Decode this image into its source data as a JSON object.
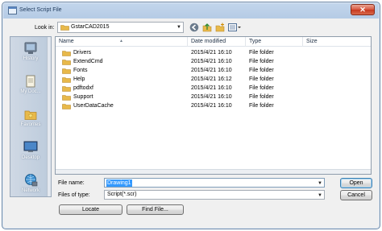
{
  "window": {
    "title": "Select Script File",
    "close_glyph": "✕"
  },
  "lookin": {
    "label": "Look in:",
    "value": "GstarCAD2015"
  },
  "places": [
    {
      "label": "History",
      "icon": "history-icon"
    },
    {
      "label": "My Doc...",
      "icon": "my-documents-icon"
    },
    {
      "label": "Favorites",
      "icon": "favorites-icon"
    },
    {
      "label": "Desktop",
      "icon": "desktop-icon"
    },
    {
      "label": "Network",
      "icon": "network-icon"
    }
  ],
  "filelist": {
    "columns": [
      "Name",
      "Date modified",
      "Type",
      "Size"
    ],
    "rows": [
      {
        "name": "Drivers",
        "date": "2015/4/21 16:10",
        "type": "File folder",
        "size": ""
      },
      {
        "name": "ExtendCmd",
        "date": "2015/4/21 16:10",
        "type": "File folder",
        "size": ""
      },
      {
        "name": "Fonts",
        "date": "2015/4/21 16:10",
        "type": "File folder",
        "size": ""
      },
      {
        "name": "Help",
        "date": "2015/4/21 16:12",
        "type": "File folder",
        "size": ""
      },
      {
        "name": "pdftodxf",
        "date": "2015/4/21 16:10",
        "type": "File folder",
        "size": ""
      },
      {
        "name": "Support",
        "date": "2015/4/21 16:10",
        "type": "File folder",
        "size": ""
      },
      {
        "name": "UserDataCache",
        "date": "2015/4/21 16:10",
        "type": "File folder",
        "size": ""
      }
    ]
  },
  "filename": {
    "label": "File name:",
    "value": "Drawing1"
  },
  "filetype": {
    "label": "Files of type:",
    "value": "Script(*.scr)"
  },
  "buttons": {
    "open": "Open",
    "cancel": "Cancel",
    "locate": "Locate",
    "find": "Find File..."
  },
  "colors": {
    "title_bar": "#c3d6ec",
    "selection": "#3399ff",
    "folder": "#e8b94a",
    "close": "#c7381e"
  }
}
